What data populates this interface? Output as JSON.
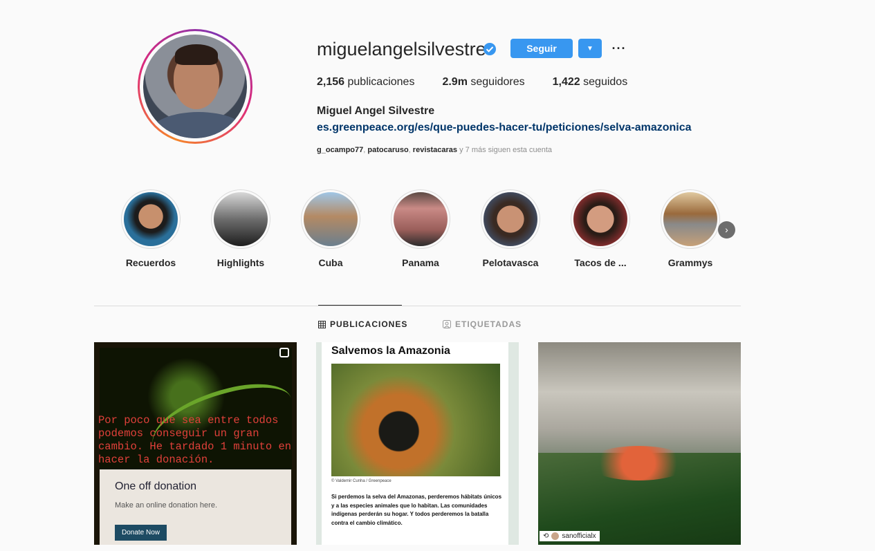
{
  "profile": {
    "username": "miguelangelsilvestre",
    "follow_label": "Seguir",
    "posts_count": "2,156",
    "posts_label": "publicaciones",
    "followers_count": "2.9m",
    "followers_label": "seguidores",
    "following_count": "1,422",
    "following_label": "seguidos",
    "full_name": "Miguel Angel Silvestre",
    "link": "es.greenpeace.org/es/que-puedes-hacer-tu/peticiones/selva-amazonica",
    "followed_by": [
      "g_ocampo77",
      "patocaruso",
      "revistacaras"
    ],
    "followed_more": "y 7 más siguen esta cuenta",
    "accent_color": "#3897f0",
    "verified_color": "#3897f0"
  },
  "highlights": [
    {
      "label": "Recuerdos"
    },
    {
      "label": "Highlights"
    },
    {
      "label": "Cuba"
    },
    {
      "label": "Panama"
    },
    {
      "label": "Pelotavasca"
    },
    {
      "label": "Tacos de ..."
    },
    {
      "label": "Grammys"
    }
  ],
  "tabs": [
    {
      "label": "PUBLICACIONES",
      "icon": "grid-icon",
      "active": true
    },
    {
      "label": "ETIQUETADAS",
      "icon": "tag-user-icon",
      "active": false
    }
  ],
  "posts": {
    "p1": {
      "caption": "Por poco que sea entre todos podemos conseguir un gran cambio. He tardado 1 minuto en hacer la donación.",
      "card_title": "One off donation",
      "card_sub": "Make an online donation here.",
      "card_button": "Donate Now"
    },
    "p2": {
      "title": "Salvemos la Amazonia",
      "credit": "© Valdemir Cunha / Greenpeace",
      "body": "Si perdemos la selva del Amazonas, perderemos hábitats únicos y a las especies animales que lo habitan. Las comunidades indígenas perderán su hogar. Y todos perderemos la batalla contra el cambio climático."
    },
    "p3": {
      "repost_user": "sanofficialx"
    }
  }
}
